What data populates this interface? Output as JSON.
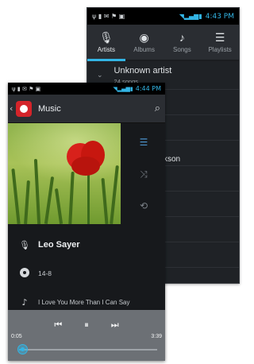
{
  "back_screen": {
    "status": {
      "icons": [
        "usb-icon",
        "battery-saver-icon",
        "message-icon",
        "notification-icon",
        "image-icon",
        "wifi-icon",
        "signal-icon",
        "battery-icon"
      ],
      "time": "4:43 PM"
    },
    "tabs": [
      {
        "label": "Artists",
        "icon": "microphone-icon",
        "active": true
      },
      {
        "label": "Albums",
        "icon": "disc-icon",
        "active": false
      },
      {
        "label": "Songs",
        "icon": "music-note-icon",
        "active": false
      },
      {
        "label": "Playlists",
        "icon": "playlist-icon",
        "active": false
      }
    ],
    "list": [
      {
        "title": "Unknown artist",
        "subtitle": "24 songs"
      }
    ],
    "partial_text": "kson"
  },
  "front_screen": {
    "status": {
      "icons": [
        "usb-icon",
        "battery-saver-icon",
        "message-icon",
        "notification-icon",
        "image-icon",
        "wifi-icon",
        "signal-icon",
        "battery-icon"
      ],
      "time": "4:44 PM"
    },
    "app": {
      "title": "Music",
      "icon": "music-app-icon"
    },
    "side_actions": [
      {
        "icon": "queue-list-icon"
      },
      {
        "icon": "shuffle-icon"
      },
      {
        "icon": "repeat-icon"
      }
    ],
    "now_playing": {
      "artist": "Leo Sayer",
      "album": "14-8",
      "song": "I Love You More Than I Can Say"
    },
    "player": {
      "elapsed": "0:05",
      "duration": "3:39",
      "progress": 0.023,
      "buttons": [
        "previous-icon",
        "pause-icon",
        "next-icon"
      ]
    }
  },
  "colors": {
    "accent": "#33b5e5",
    "panel": "#1f2226",
    "player_bar": "#6c7075",
    "logo_red": "#d4242a"
  }
}
